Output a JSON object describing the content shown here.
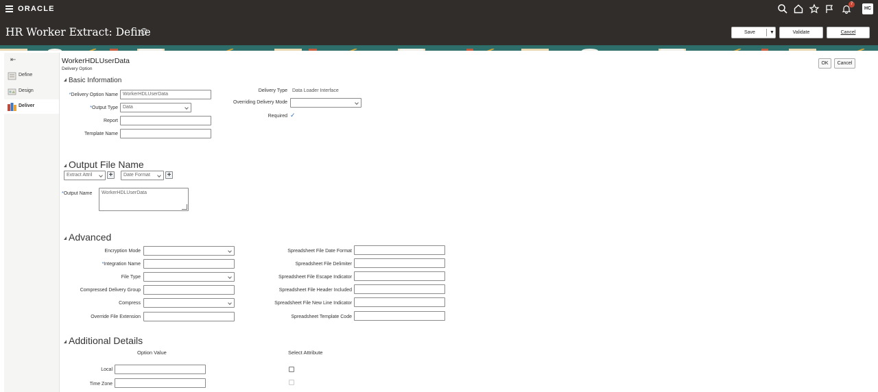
{
  "global_header": {
    "logo_text": "ORACLE",
    "icons": [
      "search-icon",
      "home-icon",
      "favorites-star-icon",
      "flag-icon",
      "notifications-bell-icon"
    ],
    "notification_count": "7",
    "avatar_initials": "HC"
  },
  "page_header": {
    "title": "HR Worker Extract: Define",
    "buttons": {
      "save": "Save",
      "validate": "Validate",
      "cancel": "Cancel"
    }
  },
  "left_nav": {
    "items": [
      {
        "label": "Define",
        "icon": "define-icon"
      },
      {
        "label": "Design",
        "icon": "design-icon"
      },
      {
        "label": "Deliver",
        "icon": "deliver-icon",
        "active": true
      }
    ]
  },
  "main": {
    "heading": "WorkerHDLUserData",
    "subheading": "Delivery Option",
    "ok_button": "OK",
    "cancel_button": "Cancel",
    "basic_info": {
      "title": "Basic Information",
      "delivery_option_name_label": "Delivery Option Name",
      "delivery_option_name_value": "WorkerHDLUserData",
      "output_type_label": "Output Type",
      "output_type_value": "Data",
      "report_label": "Report",
      "report_value": "",
      "template_name_label": "Template Name",
      "template_name_value": "",
      "delivery_type_label": "Delivery Type",
      "delivery_type_value": "Data Loader Interface",
      "overriding_mode_label": "Overriding Delivery Mode",
      "overriding_mode_value": "",
      "required_label": "Required",
      "required_checked": true
    },
    "output_file": {
      "title": "Output File Name",
      "extract_attr_value": "Extract Attril",
      "date_format_value": "Date Format",
      "output_name_label": "Output Name",
      "output_name_value": "WorkerHDLUserData"
    },
    "advanced": {
      "title": "Advanced",
      "left_fields": [
        {
          "label": "Encryption Mode",
          "value": "",
          "type": "select"
        },
        {
          "label": "Integration Name",
          "value": "",
          "type": "text",
          "required": true
        },
        {
          "label": "File Type",
          "value": "",
          "type": "select"
        },
        {
          "label": "Compressed Delivery Group",
          "value": "",
          "type": "text"
        },
        {
          "label": "Compress",
          "value": "",
          "type": "select"
        },
        {
          "label": "Override File Extension",
          "value": "",
          "type": "text"
        }
      ],
      "right_fields": [
        {
          "label": "Spreadsheet File Date Format",
          "value": ""
        },
        {
          "label": "Spreadsheet File Delimiter",
          "value": ""
        },
        {
          "label": "Spreadsheet File Escape Indicator",
          "value": ""
        },
        {
          "label": "Spreadsheet File Header Included",
          "value": ""
        },
        {
          "label": "Spreadsheet File New Line Indicator",
          "value": ""
        },
        {
          "label": "Spreadsheet Template Code",
          "value": ""
        }
      ]
    },
    "additional": {
      "title": "Additional Details",
      "col_option_value": "Option Value",
      "col_select_attribute": "Select Attribute",
      "rows": [
        {
          "label": "Local",
          "value": ""
        },
        {
          "label": "Time Zone",
          "value": ""
        }
      ]
    }
  },
  "colors": {
    "header_bg": "#312d2a",
    "required_marker": "#2c6dbb",
    "badge": "#c74634"
  }
}
